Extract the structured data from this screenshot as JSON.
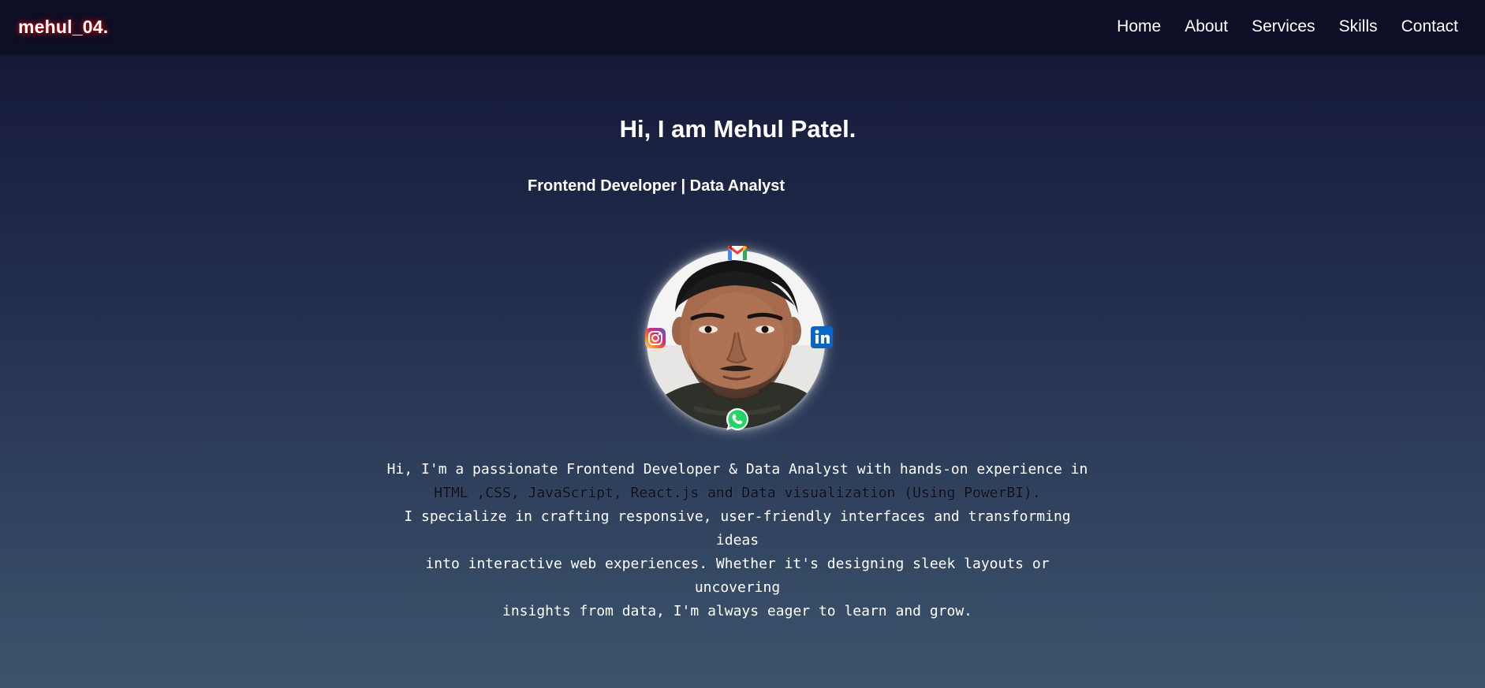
{
  "navbar": {
    "logo": "mehul_04.",
    "links": [
      "Home",
      "About",
      "Services",
      "Skills",
      "Contact"
    ]
  },
  "hero": {
    "title": "Hi, I am Mehul Patel.",
    "subtitle": "Frontend Developer | Data Analyst",
    "profile_icons": [
      "gmail-icon",
      "instagram-icon",
      "linkedin-icon",
      "whatsapp-icon"
    ]
  },
  "about": {
    "line1": "Hi, I'm a passionate Frontend Developer & Data Analyst with hands-on experience in",
    "line2": "HTML ,CSS, JavaScript, React.js and Data visualization (Using PowerBI).",
    "line3": "I specialize in crafting responsive, user-friendly interfaces and transforming ideas",
    "line4": "into interactive web experiences. Whether it's designing sleek layouts or uncovering",
    "line5": "insights from data, I'm always eager to learn and grow."
  },
  "colors": {
    "navbar_bg": "#0d0f26",
    "logo_glow": "#ff0000",
    "linkedin": "#0a66c2",
    "whatsapp": "#25d366"
  }
}
